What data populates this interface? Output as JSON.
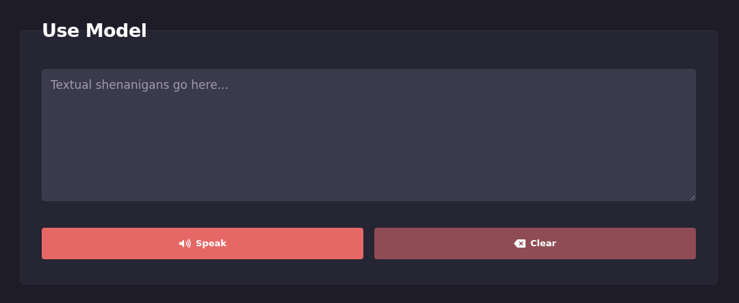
{
  "title": "Use Model",
  "input": {
    "placeholder": "Textual shenanigans go here..."
  },
  "buttons": [
    {
      "kind": "speak",
      "label": "Speak"
    },
    {
      "kind": "clear",
      "label": "Clear"
    }
  ]
}
